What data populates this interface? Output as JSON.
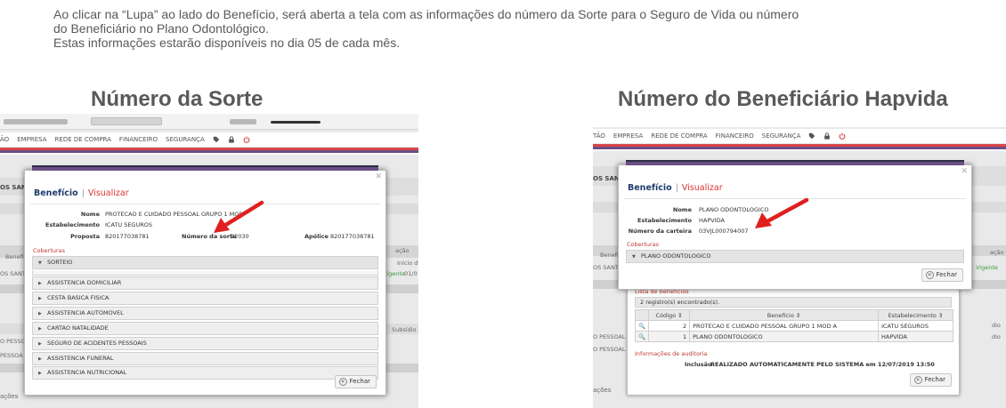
{
  "intro": {
    "line1": "Ao clicar na “Lupa” ao lado do Benefício,  será aberta a tela com as informações do número da Sorte para o Seguro de Vida ou número",
    "line2": "do Beneficiário no Plano Odontológico.",
    "line3": "Estas informações estarão disponíveis  no dia 05 de cada mês."
  },
  "left": {
    "heading": "Número da Sorte",
    "nav": [
      "ÃO",
      "EMPRESA",
      "REDE DE COMPRA",
      "FINANCEIRO",
      "SEGURANÇA"
    ],
    "bg": {
      "side_name": "OS SANTOS",
      "left1": "Benefi",
      "left2": "OS SANTO",
      "right1": "Início d",
      "right2": "01/0",
      "vigente": "Vigente",
      "subsidio": "Subsídio",
      "pessoal1": "O PESSOAL",
      "pessoal2": "PESSOA",
      "bottom": "ações",
      "acao": "ação"
    },
    "modal": {
      "title": "Benefício",
      "subtitle": "Visualizar",
      "labels": {
        "nome": "Nome",
        "estabelecimento": "Estabelecimento",
        "proposta": "Proposta",
        "numero_sorte": "Número da sorte",
        "apolice": "Apólice"
      },
      "values": {
        "nome": "PROTECAO E CUIDADO PESSOAL GRUPO 1 MOD",
        "estabelecimento": "ICATU SEGUROS",
        "proposta": "820177038781",
        "numero_sorte": "22030",
        "apolice": "820177038781"
      },
      "coberturas_label": "Coberturas",
      "coberturas": [
        "SORTEIO",
        "ASSISTENCIA DOMICILIAR",
        "CESTA BASICA FISICA",
        "ASSISTENCIA AUTOMOVEL",
        "CARTAO NATALIDADE",
        "SEGURO DE ACIDENTES PESSOAIS",
        "ASSISTENCIA FUNERAL",
        "ASSISTENCIA NUTRICIONAL"
      ],
      "close_label": "Fechar"
    }
  },
  "right": {
    "heading": "Número do Beneficiário Hapvida",
    "nav": [
      "TÃO",
      "EMPRESA",
      "REDE DE COMPRA",
      "FINANCEIRO",
      "SEGURANÇA"
    ],
    "bg": {
      "side_name": "OS SANT",
      "left1": "Benefi",
      "left2": "OS SANTO",
      "acao": "ação",
      "vigente": "Vigente",
      "pessoal1": "O PESSOAL -",
      "pessoal2": "O PESSOAL - D",
      "bottom": "ações",
      "dio1": "dio",
      "dio2": "dio"
    },
    "modal": {
      "title": "Benefício",
      "subtitle": "Visualizar",
      "labels": {
        "nome": "Nome",
        "estabelecimento": "Estabelecimento",
        "carteira": "Número da carteira"
      },
      "values": {
        "nome": "PLANO ODONTOLOGICO",
        "estabelecimento": "HAPVIDA",
        "carteira": "03VJL000794007"
      },
      "coberturas_label": "Coberturas",
      "coberturas": [
        "PLANO ODONTOLOGICO"
      ],
      "close_label": "Fechar"
    },
    "lower": {
      "list_label": "Lista de benefícios",
      "count": "2 registro(s) encontrado(s).",
      "headers": [
        "Código",
        "Benefício",
        "Estabelecimento"
      ],
      "rows": [
        {
          "code": "2",
          "benefit": "PROTECAO E CUIDADO PESSOAL GRUPO 1 MOD A",
          "estab": "ICATU SEGUROS"
        },
        {
          "code": "1",
          "benefit": "PLANO ODONTOLOGICO",
          "estab": "HAPVIDA"
        }
      ],
      "audit_label": "Informações de auditoria",
      "inclusao_label": "Inclusão",
      "inclusao_value": "REALIZADO AUTOMATICAMENTE PELO SISTEMA em 12/07/2019 13:50",
      "close_label": "Fechar"
    }
  },
  "colors": {
    "stripe_red": "#d9474a",
    "stripe_purple": "#6b4f86",
    "arrow_red": "#e02020",
    "title_blue": "#1e3c6e"
  }
}
